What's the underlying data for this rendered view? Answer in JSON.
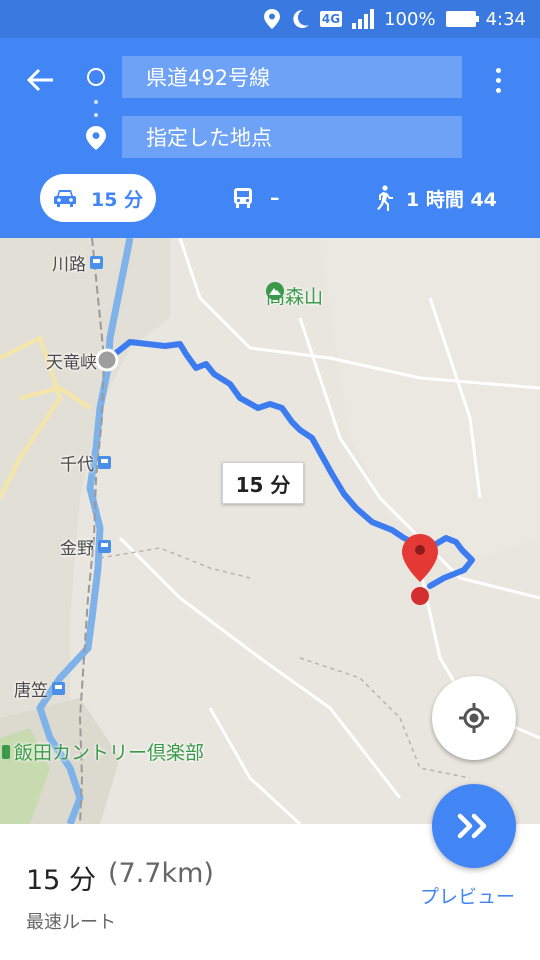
{
  "status_bar": {
    "battery": "100%",
    "time": "4:34",
    "network": "4G",
    "icons": [
      "location-icon",
      "moon-icon",
      "network-4g-icon",
      "signal-icon",
      "battery-icon"
    ]
  },
  "header": {
    "origin": "県道492号線",
    "destination": "指定した地点",
    "icons": [
      "back-arrow-icon",
      "origin-circle-icon",
      "destination-pin-icon",
      "more-vert-icon"
    ],
    "modes": {
      "car": "15 分",
      "transit": "–",
      "walk": "1 時間 44"
    }
  },
  "map": {
    "places": {
      "kawaji": "川路",
      "tenryukyo": "天竜峡",
      "chiyo": "千代",
      "kanno": "金野",
      "karakasa": "唐笠",
      "takamoriyama": "高森山",
      "golf": "飯田カントリー倶楽部"
    },
    "route_duration": "15 分",
    "colors": {
      "route": "#3d7cf0",
      "land": "#e9e6df",
      "river": "#7fb2e8",
      "pin": "#e53935"
    }
  },
  "summary": {
    "time": "15 分",
    "distance": "(7.7km)",
    "subtitle": "最速ルート",
    "preview_label": "プレビュー"
  },
  "accent": "#4285f4"
}
